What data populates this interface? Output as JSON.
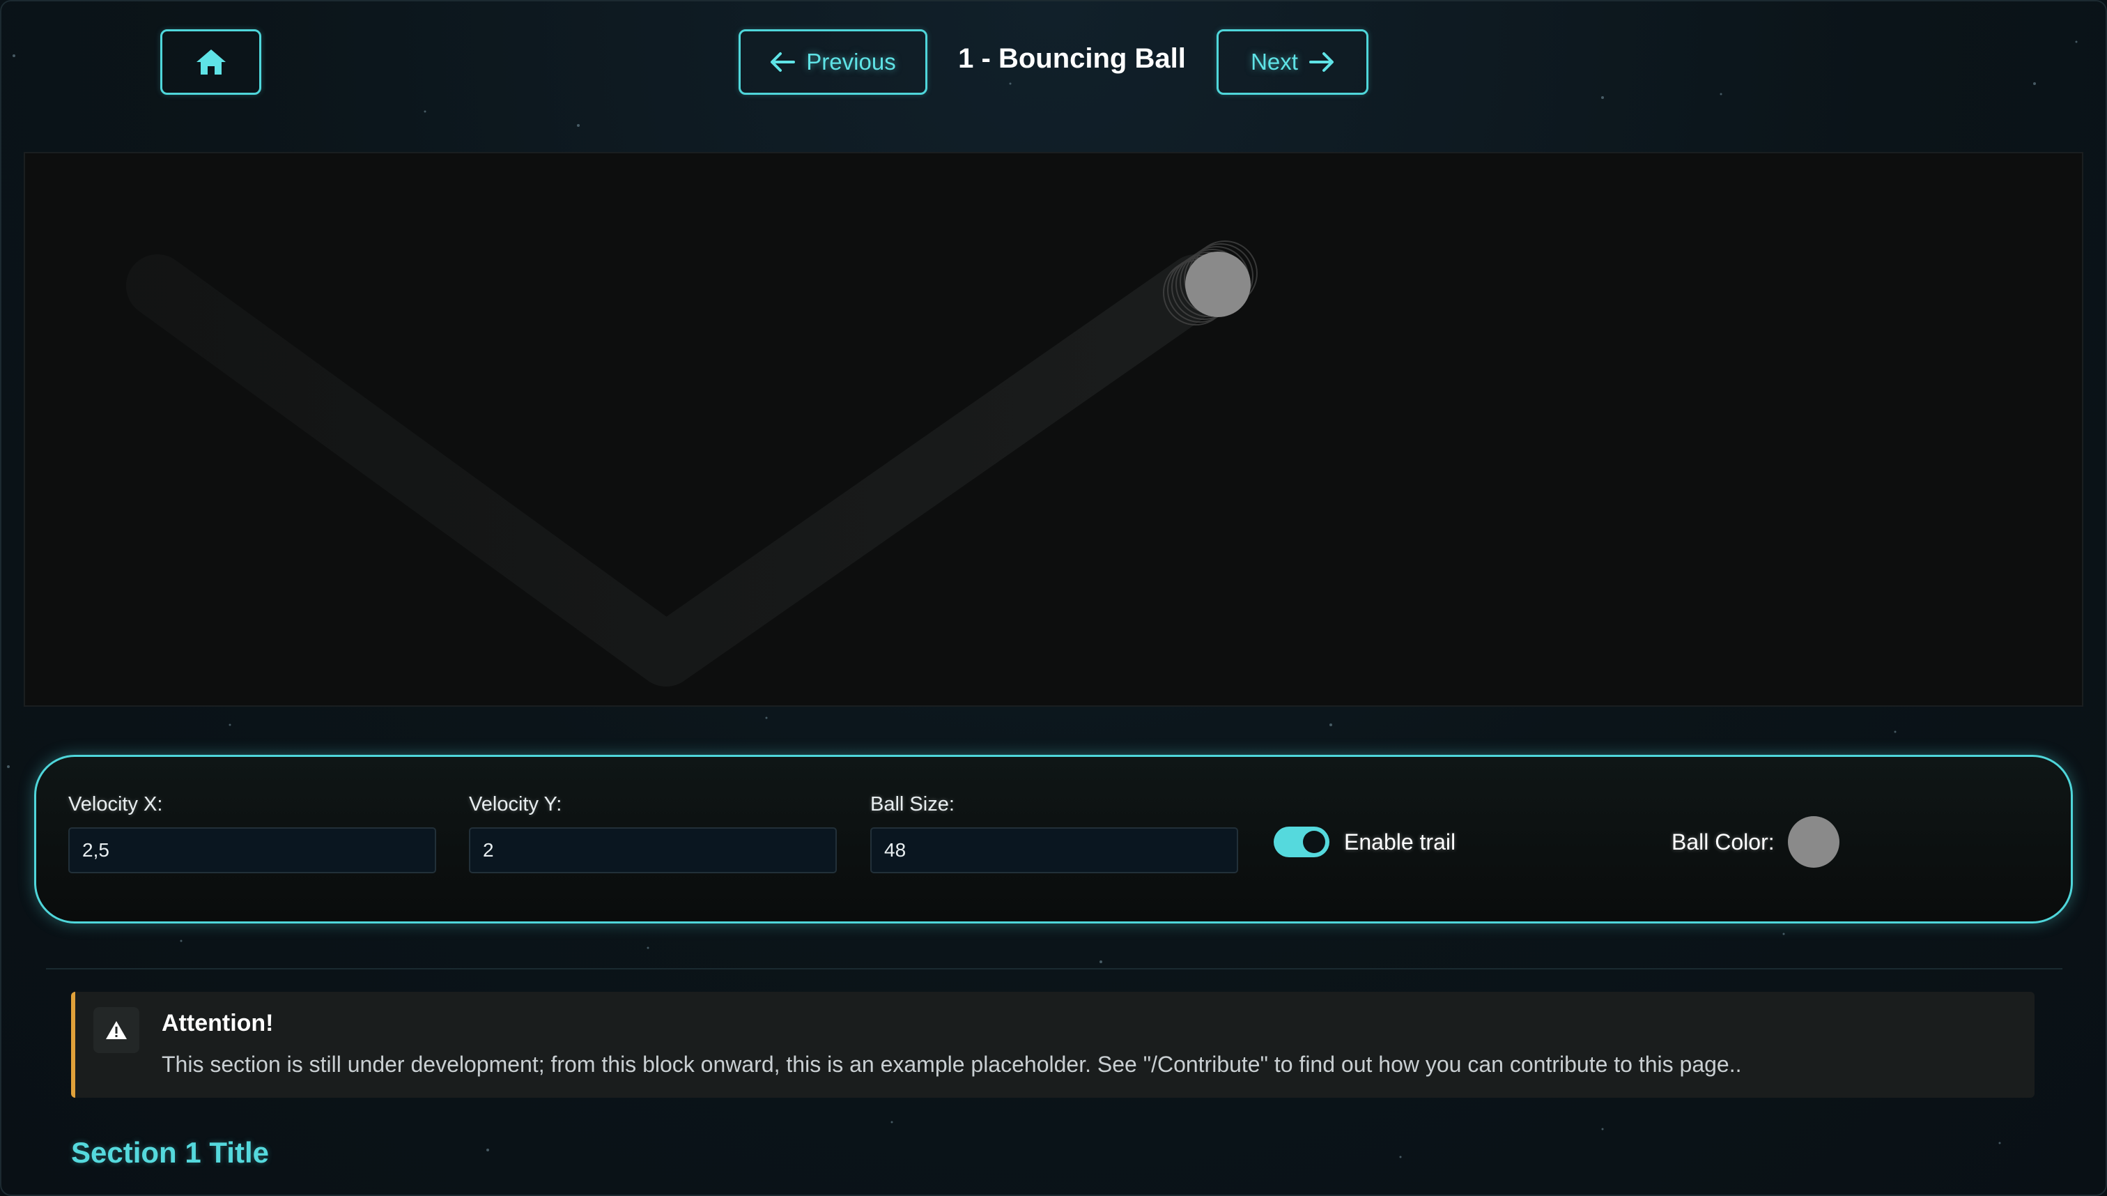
{
  "header": {
    "home_icon": "home-icon",
    "prev_label": "Previous",
    "next_label": "Next",
    "title": "1 - Bouncing Ball"
  },
  "controls": {
    "velocity_x": {
      "label": "Velocity X:",
      "value": "2,5"
    },
    "velocity_y": {
      "label": "Velocity Y:",
      "value": "2"
    },
    "ball_size": {
      "label": "Ball Size:",
      "value": "48"
    },
    "trail": {
      "label": "Enable trail",
      "enabled": true
    },
    "ball_color": {
      "label": "Ball Color:",
      "value": "#8a8a8a"
    }
  },
  "alert": {
    "title": "Attention!",
    "text": "This section is still under development; from this block onward, this is an example placeholder. See \"/Contribute\" to find out how you can contribute to this page.."
  },
  "section": {
    "title": "Section 1 Title"
  },
  "colors": {
    "accent": "#4fd6da",
    "warning": "#e0a13a",
    "canvas": "#0d0e0e",
    "ball": "#8a8a8a"
  }
}
